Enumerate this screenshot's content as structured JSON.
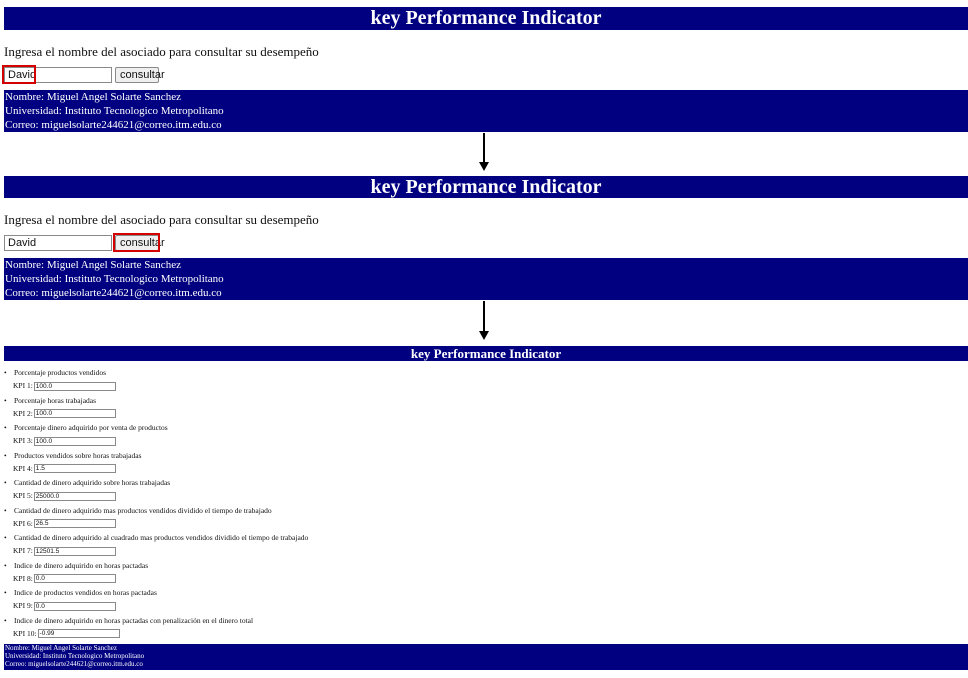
{
  "title": "key Performance Indicator",
  "prompt": "Ingresa el nombre del asociado para consultar su desempeño",
  "search_value": "David",
  "consult_button": "consultar",
  "footer": {
    "nombre": "Nombre: Miguel Angel Solarte Sanchez",
    "universidad": "Universidad: Instituto Tecnologico Metropolitano",
    "correo": "Correo: miguelsolarte244621@correo.itm.edu.co"
  },
  "kpis": [
    {
      "desc": "Porcentaje productos vendidos",
      "label": "KPI 1:",
      "value": "100.0"
    },
    {
      "desc": "Porcentaje horas trabajadas",
      "label": "KPI 2:",
      "value": "100.0"
    },
    {
      "desc": "Porcentaje dinero adquirido por venta de productos",
      "label": "KPI 3:",
      "value": "100.0"
    },
    {
      "desc": "Productos vendidos sobre horas trabajadas",
      "label": "KPI 4:",
      "value": "1.5"
    },
    {
      "desc": "Cantidad de dinero adquirido sobre horas trabajadas",
      "label": "KPI 5:",
      "value": "25000.0"
    },
    {
      "desc": "Cantidad de dinero adquirido mas productos vendidos dividido el tiempo de trabajado",
      "label": "KPI 6:",
      "value": "26.5"
    },
    {
      "desc": "Cantidad de dinero adquirido al cuadrado mas productos vendidos dividido el tiempo de trabajado",
      "label": "KPI 7:",
      "value": "12501.5"
    },
    {
      "desc": "Indice de dinero adquirido en horas pactadas",
      "label": "KPI 8:",
      "value": "0.0"
    },
    {
      "desc": "Indice de productos vendidos en horas pactadas",
      "label": "KPI 9:",
      "value": "0.0"
    },
    {
      "desc": "Indice de dinero adquirido en horas pactadas con penalización en el dinero total",
      "label": "KPI 10:",
      "value": "-0.99"
    }
  ]
}
